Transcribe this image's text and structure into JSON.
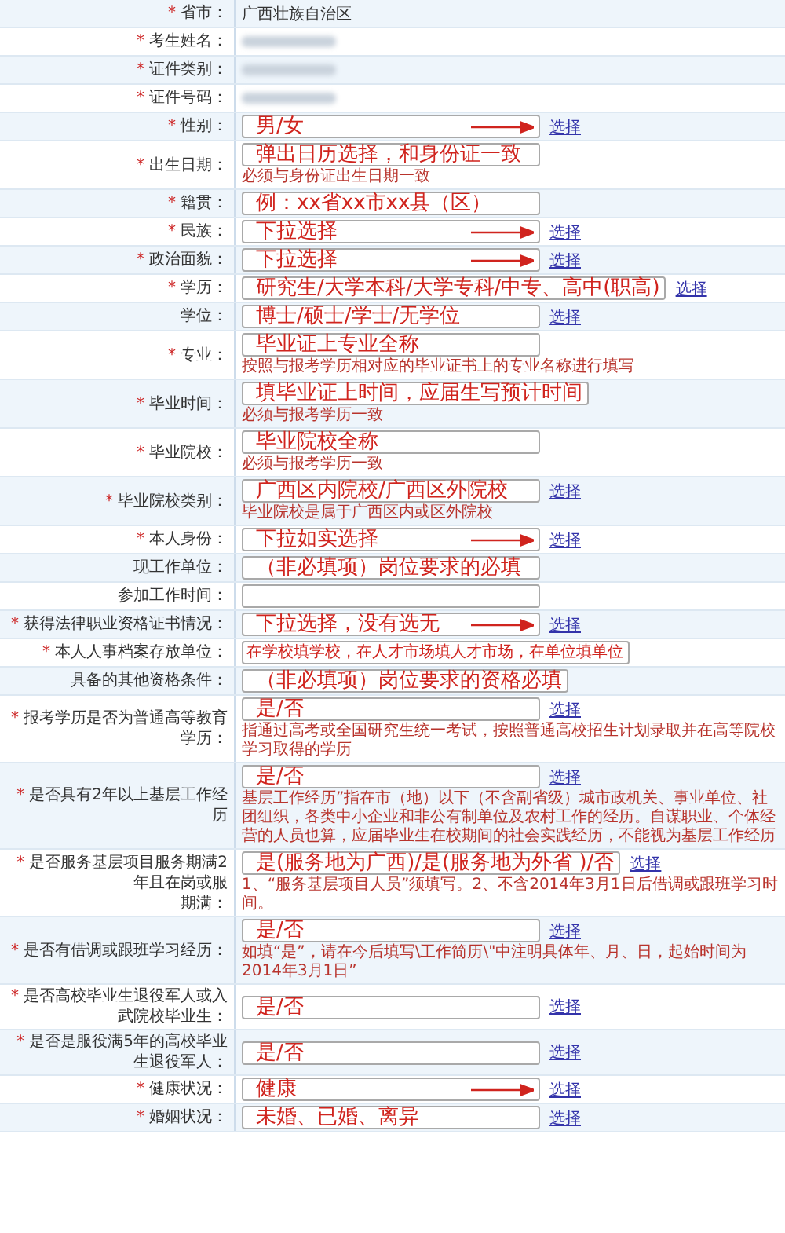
{
  "rows": [
    {
      "mark": "*",
      "label": "省市：",
      "value": "广西壮族自治区"
    },
    {
      "mark": "*",
      "label": "考生姓名：",
      "redacted": true
    },
    {
      "mark": "*",
      "label": "证件类别：",
      "redacted": true
    },
    {
      "mark": "*",
      "label": "证件号码：",
      "redacted": true
    },
    {
      "mark": "*",
      "label": "性别：",
      "field": true,
      "link": "选择",
      "arrow": true,
      "annotation": "男/女"
    },
    {
      "mark": "*",
      "label": "出生日期：",
      "field": true,
      "annotation": "弹出日历选择，和身份证一致",
      "hint": "必须与身份证出生日期一致"
    },
    {
      "mark": "*",
      "label": "籍贯：",
      "field": true,
      "annotation": "例：xx省xx市xx县（区）"
    },
    {
      "mark": "*",
      "label": "民族：",
      "field": true,
      "link": "选择",
      "arrow": true,
      "annotation": "下拉选择"
    },
    {
      "mark": "*",
      "label": "政治面貌：",
      "field": true,
      "link": "选择",
      "arrow": true,
      "annotation": "下拉选择"
    },
    {
      "mark": "*",
      "label": "学历：",
      "field": true,
      "link": "选择",
      "annotation": "研究生/大学本科/大学专科/中专、高中(职高)"
    },
    {
      "label": "学位：",
      "field": true,
      "link": "选择",
      "annotation": "博士/硕士/学士/无学位"
    },
    {
      "mark": "*",
      "label": "专业：",
      "field": true,
      "annotation": "毕业证上专业全称",
      "hint": "按照与报考学历相对应的毕业证书上的专业名称进行填写"
    },
    {
      "mark": "*",
      "label": "毕业时间：",
      "field": true,
      "annotation": "填毕业证上时间，应届生写预计时间",
      "hint": "必须与报考学历一致"
    },
    {
      "mark": "*",
      "label": "毕业院校：",
      "field": true,
      "annotation": "毕业院校全称",
      "hint": "必须与报考学历一致"
    },
    {
      "mark": "*",
      "label": "毕业院校类别：",
      "field": true,
      "link": "选择",
      "annotation": "广西区内院校/广西区外院校",
      "hint": "毕业院校是属于广西区内或区外院校"
    },
    {
      "mark": "*",
      "label": "本人身份：",
      "field": true,
      "link": "选择",
      "arrow": true,
      "annotation": "下拉如实选择"
    },
    {
      "label": "现工作单位：",
      "field": true,
      "annotation": "（非必填项）岗位要求的必填"
    },
    {
      "label": "参加工作时间：",
      "field": true
    },
    {
      "mark": "*",
      "label": "获得法律职业资格证书情况：",
      "field": true,
      "link": "选择",
      "arrow": true,
      "annotation": "下拉选择，没有选无"
    },
    {
      "mark": "*",
      "label": "本人人事档案存放单位：",
      "field": true,
      "annotation": "在学校填学校，在人才市场填人才市场，在单位填单位",
      "small_annotation": true
    },
    {
      "label": "具备的其他资格条件：",
      "field": true,
      "annotation": "（非必填项）岗位要求的资格必填"
    },
    {
      "mark": "*",
      "label": "报考学历是否为普通高等教育学历：",
      "field": true,
      "link": "选择",
      "annotation": "是/否",
      "hint": "指通过高考或全国研究生统一考试，按照普通高校招生计划录取并在高等院校学习取得的学历"
    },
    {
      "mark": "*",
      "label": "是否具有2年以上基层工作经历",
      "field": true,
      "link": "选择",
      "annotation": "是/否",
      "hint": "基层工作经历”指在市（地）以下（不含副省级）城市政机关、事业单位、社团组织，各类中小企业和非公有制单位及农村工作的经历。自谋职业、个体经营的人员也算，应届毕业生在校期间的社会实践经历，不能视为基层工作经历"
    },
    {
      "mark": "*",
      "label": "是否服务基层项目服务期满2年且在岗或服",
      "label_2": "期满：",
      "field": true,
      "link": "选择",
      "annotation": "是(服务地为广西)/是(服务地为外省 )/否",
      "hint": "1、“服务基层项目人员”须填写。2、不含2014年3月1日后借调或跟班学习时间。"
    },
    {
      "mark": "*",
      "label": "是否有借调或跟班学习经历：",
      "field": true,
      "link": "选择",
      "annotation": "是/否",
      "hint": "如填“是”，请在今后填写\\工作简历\\\"中注明具体年、月、日，起始时间为2014年3月1日”"
    },
    {
      "mark": "*",
      "label": "是否高校毕业生退役军人或入武院校毕业生：",
      "field": true,
      "link": "选择",
      "annotation": "是/否"
    },
    {
      "mark": "*",
      "label": "是否是服役满5年的高校毕业生退役军人：",
      "field": true,
      "link": "选择",
      "annotation": "是/否"
    },
    {
      "mark": "*",
      "label": "健康状况：",
      "field": true,
      "link": "选择",
      "arrow": true,
      "annotation": "健康"
    },
    {
      "mark": "*",
      "label": "婚姻状况：",
      "field": true,
      "link": "选择",
      "annotation": "未婚、已婚、离异"
    }
  ]
}
